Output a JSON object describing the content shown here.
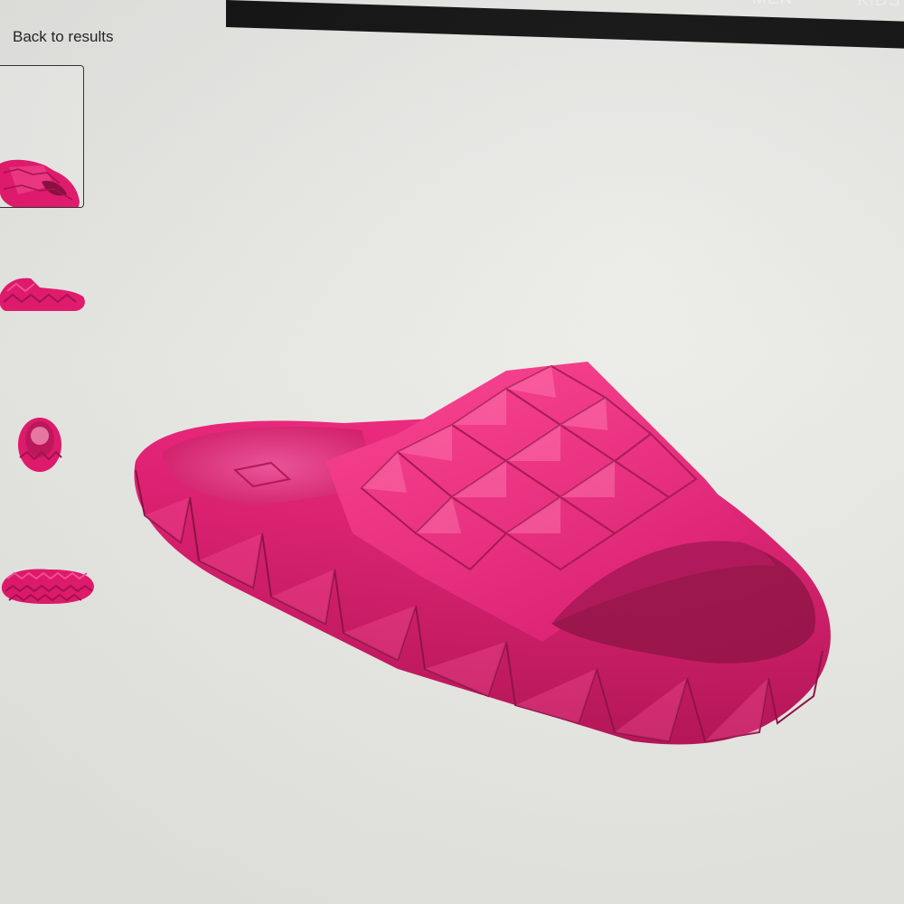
{
  "header": {
    "nav_items": [
      {
        "label": "",
        "partial": true
      },
      {
        "label": "MEN",
        "partial": true
      },
      {
        "label": "KIDS",
        "partial": true
      }
    ]
  },
  "back_link": {
    "label": "Back to results"
  },
  "gallery": {
    "thumbnails": [
      {
        "view": "angled",
        "selected": true
      },
      {
        "view": "side",
        "selected": false
      },
      {
        "view": "back",
        "selected": false
      },
      {
        "view": "sole",
        "selected": false
      }
    ]
  },
  "product": {
    "color": "#e8176e",
    "shade_dark": "#a80f4e",
    "shade_light": "#ff4f98"
  }
}
